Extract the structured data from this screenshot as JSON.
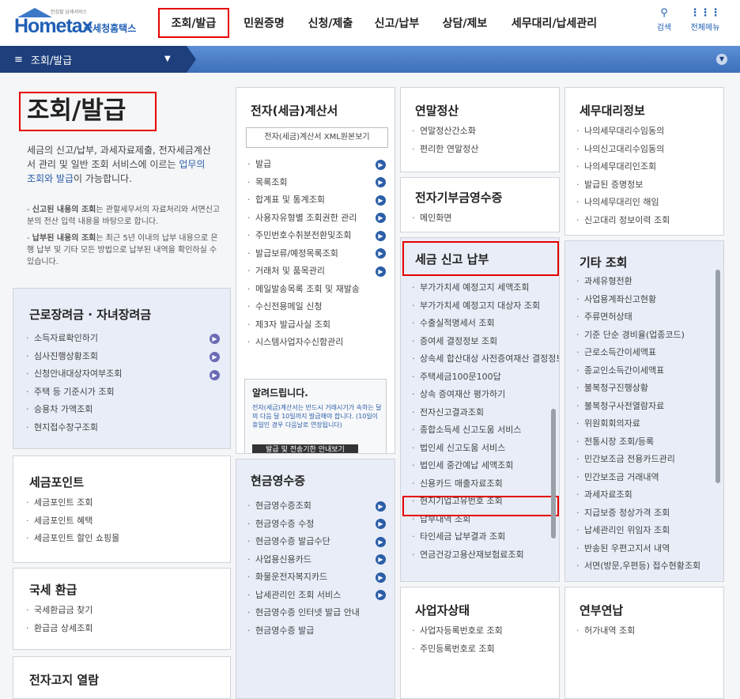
{
  "header": {
    "logo_small": "안심할 납세서비스",
    "logo_main": "Hometax",
    "logo_sub": "국세청홈택스",
    "nav": [
      "조회/발급",
      "민원증명",
      "신청/제출",
      "신고/납부",
      "상담/제보",
      "세무대리/납세관리"
    ],
    "search_label": "검색",
    "menu_label": "전체메뉴"
  },
  "breadcrumb": {
    "label": "조회/발급"
  },
  "intro": {
    "title": "조회/발급",
    "desc_1": "세금의 신고/납부, 과세자료제출, 전자세금계산서 관리 및 일반 조회 서비스에 이르는 ",
    "desc_hl": "업무의 조회와 발급",
    "desc_2": "이 가능합니다.",
    "note1_strong": "신고된 내용의 조회",
    "note1": "는 관할세무서의 자료처리와 서면신고분의 전산 입력 내용을 바탕으로 합니다.",
    "note2_strong": "납부된 내용의 조회",
    "note2": "는 최근 5년 이내의 납부 내용으로 은행 납부 및 기타 모든 방법으로 납부된 내역을 확인하실 수 있습니다."
  },
  "sections": {
    "einvoice": {
      "title": "전자(세금)계산서",
      "xml_btn": "전자(세금)계산서 XML원본보기",
      "items": [
        "발급",
        "목록조회",
        "합계표 및 통계조회",
        "사용자유형별 조회권한 관리",
        "주민번호수취분전환및조회",
        "발급보류/예정목록조회",
        "거래처 및 품목관리",
        "메일발송목록 조회 및 재발송",
        "수신전용메일 신청",
        "제3자 발급사실 조회",
        "시스템사업자수신함관리"
      ],
      "notice_title": "알려드립니다.",
      "notice_body": "전자(세금)계산서는 반드시 거래시기가 속하는 달의 다음 달 10일까지 발급해야 합니다. (10일이 휴일인 경우 다음날로 연장됩니다)",
      "notice_btn": "발급 및 전송기한 안내보기"
    },
    "yearend": {
      "title": "연말정산",
      "items": [
        "연말정산간소화",
        "편리한 연말정산"
      ]
    },
    "donation": {
      "title": "전자기부금영수증",
      "items": [
        "메인화면"
      ]
    },
    "agent": {
      "title": "세무대리정보",
      "items": [
        "나의세무대리수임동의",
        "나의신고대리수임동의",
        "나의세무대리인조회",
        "발급된 증명정보",
        "나의세무대리인 해임",
        "신고대리 정보이력 조회"
      ]
    },
    "tax": {
      "title": "세금 신고 납부",
      "items": [
        "부가가치세 예정고지 세액조회",
        "부가가치세 예정고지 대상자 조회",
        "수출실적명세서 조회",
        "증여세 결정정보 조회",
        "상속세 합산대상 사전증여재산 결정정보 조회",
        "주택세금100문100답",
        "상속 증여재산 평가하기",
        "전자신고결과조회",
        "종합소득세 신고도움 서비스",
        "법인세 신고도움 서비스",
        "법인세 중간예납 세액조회",
        "신용카드 매출자료조회",
        "현지기업고유번호 조회",
        "납부내역 조회",
        "타인세금 납부결과 조회",
        "연금건강고용산재보험료조회"
      ]
    },
    "etc": {
      "title": "기타 조회",
      "items": [
        "과세유형전환",
        "사업용계좌신고현황",
        "주류면허상태",
        "기준 단순 경비율(업종코드)",
        "근로소득간이세액표",
        "종교인소득간이세액표",
        "불복청구진행상황",
        "불복청구사전열람자료",
        "위원회회의자료",
        "전통시장 조회/등록",
        "민간보조금 전용카드관리",
        "민간보조금 거래내역",
        "과세자료조회",
        "지급보증 정상가격 조회",
        "납세관리인 위임자 조회",
        "반송된 우편고지서 내역",
        "서면(방문,우편등) 접수현황조회"
      ]
    },
    "earned": {
      "title": "근로장려금 · 자녀장려금",
      "items": [
        "소득자료확인하기",
        "심사진행상황조회",
        "신청안내대상자여부조회",
        "주택 등 기준시가 조회",
        "승용차 가액조회",
        "현지접수창구조회"
      ]
    },
    "points": {
      "title": "세금포인트",
      "items": [
        "세금포인트 조회",
        "세금포인트 혜택",
        "세금포인트 할인 쇼핑몰"
      ]
    },
    "refund": {
      "title": "국세 환급",
      "items": [
        "국세환급금 찾기",
        "환급금 상세조회"
      ]
    },
    "ebill": {
      "title": "전자고지 열람"
    },
    "cash": {
      "title": "현금영수증",
      "items": [
        "현금영수증조회",
        "현금영수증 수정",
        "현금영수증 발급수단",
        "사업용신용카드",
        "화물운전자복지카드",
        "납세관리인 조회 서비스",
        "현금영수증 인터넷 발급 안내",
        "현금영수증 발급"
      ]
    },
    "biz": {
      "title": "사업자상태",
      "items": [
        "사업자등록번호로 조회",
        "주민등록번호로 조회"
      ]
    },
    "annual": {
      "title": "연부연납",
      "items": [
        "허가내역 조회"
      ]
    }
  }
}
